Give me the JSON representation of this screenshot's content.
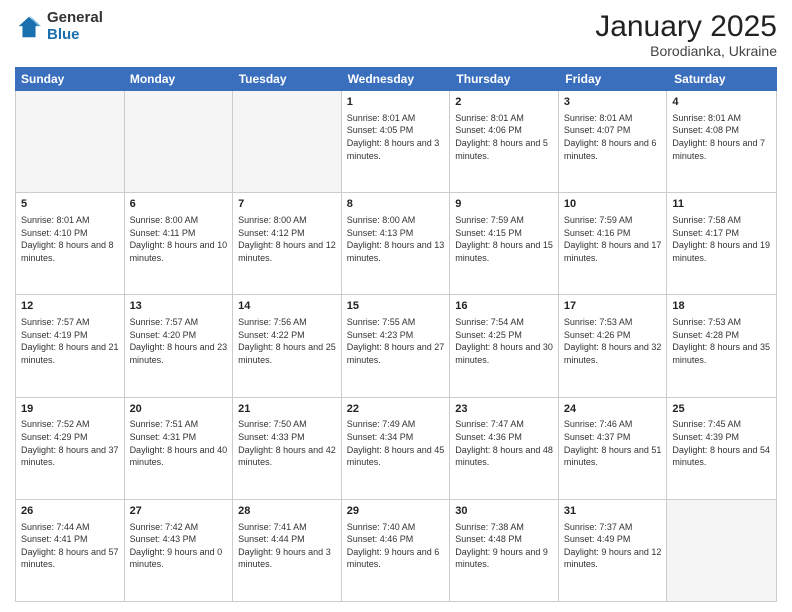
{
  "logo": {
    "general": "General",
    "blue": "Blue"
  },
  "header": {
    "title": "January 2025",
    "subtitle": "Borodianka, Ukraine"
  },
  "weekdays": [
    "Sunday",
    "Monday",
    "Tuesday",
    "Wednesday",
    "Thursday",
    "Friday",
    "Saturday"
  ],
  "weeks": [
    [
      {
        "day": "",
        "info": ""
      },
      {
        "day": "",
        "info": ""
      },
      {
        "day": "",
        "info": ""
      },
      {
        "day": "1",
        "info": "Sunrise: 8:01 AM\nSunset: 4:05 PM\nDaylight: 8 hours and 3 minutes."
      },
      {
        "day": "2",
        "info": "Sunrise: 8:01 AM\nSunset: 4:06 PM\nDaylight: 8 hours and 5 minutes."
      },
      {
        "day": "3",
        "info": "Sunrise: 8:01 AM\nSunset: 4:07 PM\nDaylight: 8 hours and 6 minutes."
      },
      {
        "day": "4",
        "info": "Sunrise: 8:01 AM\nSunset: 4:08 PM\nDaylight: 8 hours and 7 minutes."
      }
    ],
    [
      {
        "day": "5",
        "info": "Sunrise: 8:01 AM\nSunset: 4:10 PM\nDaylight: 8 hours and 8 minutes."
      },
      {
        "day": "6",
        "info": "Sunrise: 8:00 AM\nSunset: 4:11 PM\nDaylight: 8 hours and 10 minutes."
      },
      {
        "day": "7",
        "info": "Sunrise: 8:00 AM\nSunset: 4:12 PM\nDaylight: 8 hours and 12 minutes."
      },
      {
        "day": "8",
        "info": "Sunrise: 8:00 AM\nSunset: 4:13 PM\nDaylight: 8 hours and 13 minutes."
      },
      {
        "day": "9",
        "info": "Sunrise: 7:59 AM\nSunset: 4:15 PM\nDaylight: 8 hours and 15 minutes."
      },
      {
        "day": "10",
        "info": "Sunrise: 7:59 AM\nSunset: 4:16 PM\nDaylight: 8 hours and 17 minutes."
      },
      {
        "day": "11",
        "info": "Sunrise: 7:58 AM\nSunset: 4:17 PM\nDaylight: 8 hours and 19 minutes."
      }
    ],
    [
      {
        "day": "12",
        "info": "Sunrise: 7:57 AM\nSunset: 4:19 PM\nDaylight: 8 hours and 21 minutes."
      },
      {
        "day": "13",
        "info": "Sunrise: 7:57 AM\nSunset: 4:20 PM\nDaylight: 8 hours and 23 minutes."
      },
      {
        "day": "14",
        "info": "Sunrise: 7:56 AM\nSunset: 4:22 PM\nDaylight: 8 hours and 25 minutes."
      },
      {
        "day": "15",
        "info": "Sunrise: 7:55 AM\nSunset: 4:23 PM\nDaylight: 8 hours and 27 minutes."
      },
      {
        "day": "16",
        "info": "Sunrise: 7:54 AM\nSunset: 4:25 PM\nDaylight: 8 hours and 30 minutes."
      },
      {
        "day": "17",
        "info": "Sunrise: 7:53 AM\nSunset: 4:26 PM\nDaylight: 8 hours and 32 minutes."
      },
      {
        "day": "18",
        "info": "Sunrise: 7:53 AM\nSunset: 4:28 PM\nDaylight: 8 hours and 35 minutes."
      }
    ],
    [
      {
        "day": "19",
        "info": "Sunrise: 7:52 AM\nSunset: 4:29 PM\nDaylight: 8 hours and 37 minutes."
      },
      {
        "day": "20",
        "info": "Sunrise: 7:51 AM\nSunset: 4:31 PM\nDaylight: 8 hours and 40 minutes."
      },
      {
        "day": "21",
        "info": "Sunrise: 7:50 AM\nSunset: 4:33 PM\nDaylight: 8 hours and 42 minutes."
      },
      {
        "day": "22",
        "info": "Sunrise: 7:49 AM\nSunset: 4:34 PM\nDaylight: 8 hours and 45 minutes."
      },
      {
        "day": "23",
        "info": "Sunrise: 7:47 AM\nSunset: 4:36 PM\nDaylight: 8 hours and 48 minutes."
      },
      {
        "day": "24",
        "info": "Sunrise: 7:46 AM\nSunset: 4:37 PM\nDaylight: 8 hours and 51 minutes."
      },
      {
        "day": "25",
        "info": "Sunrise: 7:45 AM\nSunset: 4:39 PM\nDaylight: 8 hours and 54 minutes."
      }
    ],
    [
      {
        "day": "26",
        "info": "Sunrise: 7:44 AM\nSunset: 4:41 PM\nDaylight: 8 hours and 57 minutes."
      },
      {
        "day": "27",
        "info": "Sunrise: 7:42 AM\nSunset: 4:43 PM\nDaylight: 9 hours and 0 minutes."
      },
      {
        "day": "28",
        "info": "Sunrise: 7:41 AM\nSunset: 4:44 PM\nDaylight: 9 hours and 3 minutes."
      },
      {
        "day": "29",
        "info": "Sunrise: 7:40 AM\nSunset: 4:46 PM\nDaylight: 9 hours and 6 minutes."
      },
      {
        "day": "30",
        "info": "Sunrise: 7:38 AM\nSunset: 4:48 PM\nDaylight: 9 hours and 9 minutes."
      },
      {
        "day": "31",
        "info": "Sunrise: 7:37 AM\nSunset: 4:49 PM\nDaylight: 9 hours and 12 minutes."
      },
      {
        "day": "",
        "info": ""
      }
    ]
  ]
}
